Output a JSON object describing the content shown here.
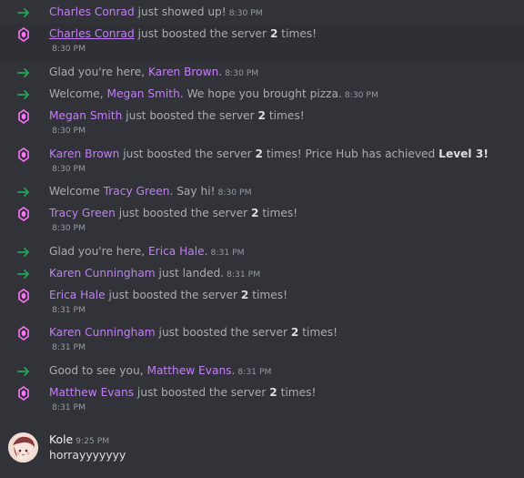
{
  "colors": {
    "background": "#313338",
    "highlight_row": "#2e3035",
    "username": "#c27ff5",
    "join_arrow": "#23a55a",
    "boost": "#ff73fa"
  },
  "messages": [
    {
      "kind": "join",
      "icon": "join-arrow-icon",
      "parts": [
        {
          "t": "Charles Conrad",
          "c": "name"
        },
        {
          "t": " just showed up!",
          "c": "text"
        }
      ],
      "time": "8:30 PM"
    },
    {
      "kind": "boost",
      "icon": "boost-gem-icon",
      "parts": [
        {
          "t": "Charles Conrad",
          "c": "name"
        },
        {
          "t": " just boosted the server ",
          "c": "text"
        },
        {
          "t": "2",
          "c": "bold"
        },
        {
          "t": " times!",
          "c": "text"
        }
      ],
      "time": "8:30 PM",
      "highlighted": true
    },
    {
      "kind": "join",
      "icon": "join-arrow-icon",
      "parts": [
        {
          "t": "Glad you're here, ",
          "c": "text"
        },
        {
          "t": "Karen Brown",
          "c": "name"
        },
        {
          "t": ".",
          "c": "text"
        }
      ],
      "time": "8:30 PM"
    },
    {
      "kind": "join",
      "icon": "join-arrow-icon",
      "parts": [
        {
          "t": "Welcome, ",
          "c": "text"
        },
        {
          "t": "Megan Smith",
          "c": "name"
        },
        {
          "t": ". We hope you brought pizza.",
          "c": "text"
        }
      ],
      "time": "8:30 PM"
    },
    {
      "kind": "boost",
      "icon": "boost-gem-icon",
      "parts": [
        {
          "t": "Megan Smith",
          "c": "name"
        },
        {
          "t": " just boosted the server ",
          "c": "text"
        },
        {
          "t": "2",
          "c": "bold"
        },
        {
          "t": " times!",
          "c": "text"
        }
      ],
      "time": "8:30 PM"
    },
    {
      "kind": "boost",
      "icon": "boost-gem-icon",
      "parts": [
        {
          "t": "Karen Brown",
          "c": "name"
        },
        {
          "t": " just boosted the server ",
          "c": "text"
        },
        {
          "t": "2",
          "c": "bold"
        },
        {
          "t": " times! Price Hub has achieved ",
          "c": "text"
        },
        {
          "t": "Level 3!",
          "c": "bold"
        }
      ],
      "time": "8:30 PM"
    },
    {
      "kind": "join",
      "icon": "join-arrow-icon",
      "parts": [
        {
          "t": "Welcome ",
          "c": "text"
        },
        {
          "t": "Tracy Green",
          "c": "name"
        },
        {
          "t": ". Say hi!",
          "c": "text"
        }
      ],
      "time": "8:30 PM"
    },
    {
      "kind": "boost",
      "icon": "boost-gem-icon",
      "parts": [
        {
          "t": "Tracy Green",
          "c": "name"
        },
        {
          "t": " just boosted the server ",
          "c": "text"
        },
        {
          "t": "2",
          "c": "bold"
        },
        {
          "t": " times!",
          "c": "text"
        }
      ],
      "time": "8:30 PM"
    },
    {
      "kind": "join",
      "icon": "join-arrow-icon",
      "parts": [
        {
          "t": "Glad you're here, ",
          "c": "text"
        },
        {
          "t": "Erica Hale",
          "c": "name"
        },
        {
          "t": ".",
          "c": "text"
        }
      ],
      "time": "8:31 PM"
    },
    {
      "kind": "join",
      "icon": "join-arrow-icon",
      "parts": [
        {
          "t": "Karen Cunningham",
          "c": "name"
        },
        {
          "t": " just landed.",
          "c": "text"
        }
      ],
      "time": "8:31 PM"
    },
    {
      "kind": "boost",
      "icon": "boost-gem-icon",
      "parts": [
        {
          "t": "Erica Hale",
          "c": "name"
        },
        {
          "t": " just boosted the server ",
          "c": "text"
        },
        {
          "t": "2",
          "c": "bold"
        },
        {
          "t": " times!",
          "c": "text"
        }
      ],
      "time": "8:31 PM"
    },
    {
      "kind": "boost",
      "icon": "boost-gem-icon",
      "parts": [
        {
          "t": "Karen Cunningham",
          "c": "name"
        },
        {
          "t": " just boosted the server ",
          "c": "text"
        },
        {
          "t": "2",
          "c": "bold"
        },
        {
          "t": " times!",
          "c": "text"
        }
      ],
      "time": "8:31 PM"
    },
    {
      "kind": "join",
      "icon": "join-arrow-icon",
      "parts": [
        {
          "t": "Good to see you, ",
          "c": "text"
        },
        {
          "t": "Matthew Evans",
          "c": "name"
        },
        {
          "t": ".",
          "c": "text"
        }
      ],
      "time": "8:31 PM"
    },
    {
      "kind": "boost",
      "icon": "boost-gem-icon",
      "parts": [
        {
          "t": "Matthew Evans",
          "c": "name"
        },
        {
          "t": " just boosted the server ",
          "c": "text"
        },
        {
          "t": "2",
          "c": "bold"
        },
        {
          "t": " times!",
          "c": "text"
        }
      ],
      "time": "8:31 PM"
    }
  ],
  "user_message": {
    "author": "Kole",
    "time": "9:25 PM",
    "text": "horrayyyyyyy",
    "avatar_icon": "user-avatar-icon"
  }
}
